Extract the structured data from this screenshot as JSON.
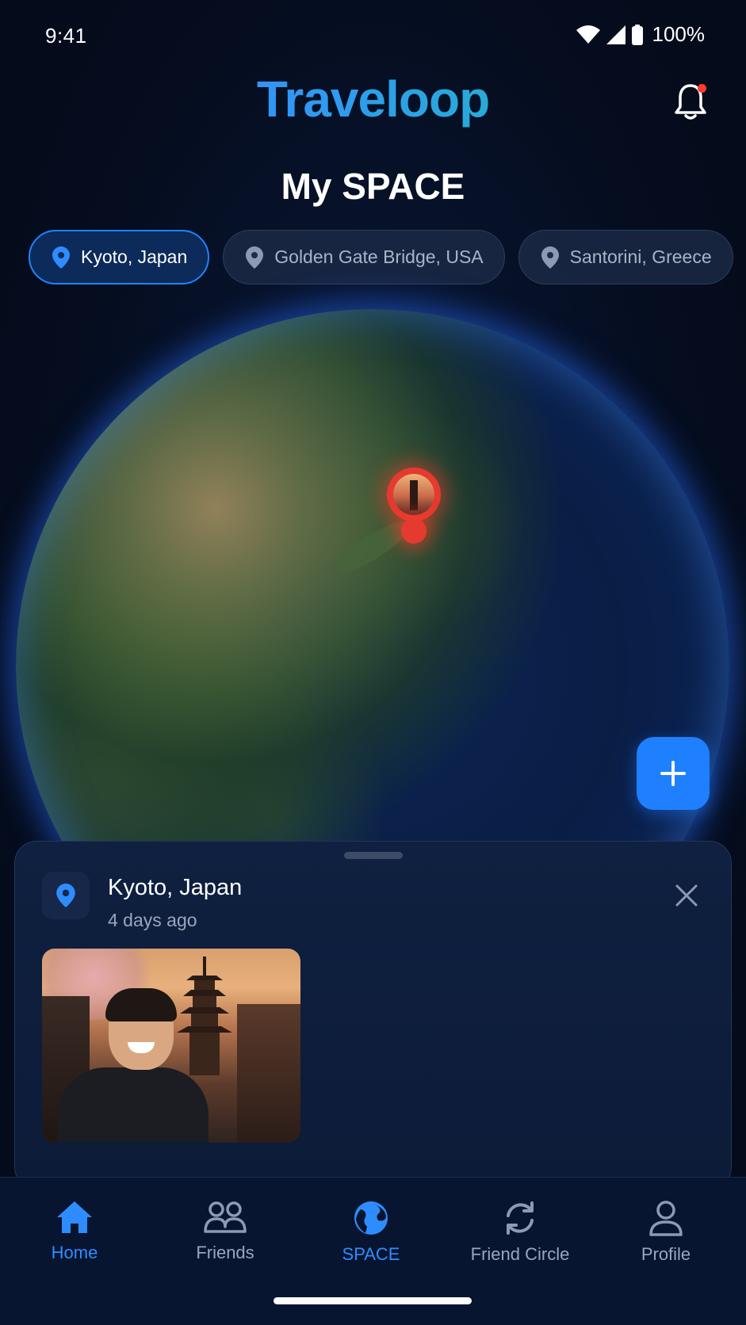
{
  "status_bar": {
    "time": "9:41",
    "battery": "100%"
  },
  "header": {
    "app_name": "Traveloop",
    "page_title": "My SPACE",
    "notification_badge_color": "#ff3b30"
  },
  "locations": [
    {
      "label": "Kyoto, Japan",
      "active": true
    },
    {
      "label": "Golden Gate Bridge, USA",
      "active": false
    },
    {
      "label": "Santorini, Greece",
      "active": false
    }
  ],
  "globe": {
    "marker_icon": "photo-pin-icon",
    "fab_icon": "plus-icon"
  },
  "detail_sheet": {
    "title": "Kyoto, Japan",
    "subtitle": "4 days ago",
    "close_icon": "close-icon"
  },
  "bottom_nav": {
    "items": [
      {
        "label": "Home",
        "icon": "home-icon",
        "active": true
      },
      {
        "label": "Friends",
        "icon": "friends-icon",
        "active": false
      },
      {
        "label": "SPACE",
        "icon": "globe-icon",
        "active": true
      },
      {
        "label": "Friend Circle",
        "icon": "refresh-icon",
        "active": false
      },
      {
        "label": "Profile",
        "icon": "profile-icon",
        "active": false
      }
    ]
  },
  "colors": {
    "accent": "#1e84ff",
    "background": "#050d1f",
    "marker": "#e53a2f"
  }
}
